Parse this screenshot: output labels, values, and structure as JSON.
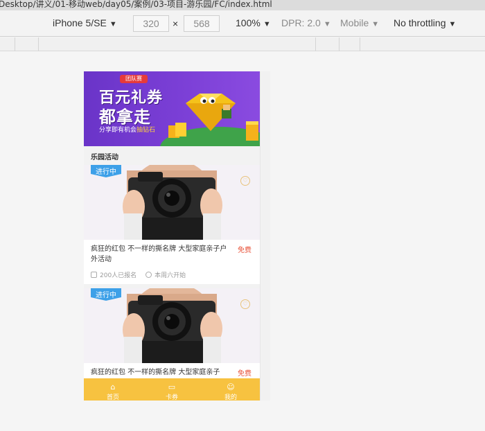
{
  "window": {
    "path": "Desktop/讲义/01-移动web/day05/案例/03-项目-游乐园/FC/index.html"
  },
  "devtools": {
    "device": "iPhone 5/SE",
    "width": "320",
    "times": "×",
    "height": "568",
    "zoom": "100%",
    "dpr": "DPR: 2.0",
    "mode": "Mobile",
    "throttle": "No throttling",
    "caret": "▼"
  },
  "banner": {
    "tag": "团队赛",
    "title1": "百元礼券",
    "title2": "都拿走",
    "subtitle_a": "分享即有机会",
    "subtitle_b": "抽钻石"
  },
  "section": {
    "title": "乐园活动"
  },
  "cards": [
    {
      "badge": "进行中",
      "heart_icon": "heart-icon",
      "desc": "疯狂的红包 不一样的撕名牌 大型家庭亲子户外活动",
      "price": "免费",
      "signups": "200人已报名",
      "start": "本周六开始"
    },
    {
      "badge": "进行中",
      "heart_icon": "heart-icon",
      "desc": "疯狂的红包 不一样的撕名牌 大型家庭亲子",
      "price": "免费"
    }
  ],
  "tabs": [
    {
      "label": "首页",
      "icon": "home-icon"
    },
    {
      "label": "卡券",
      "icon": "ticket-icon"
    },
    {
      "label": "我的",
      "icon": "user-icon"
    }
  ],
  "colors": {
    "tabbar": "#f7c240",
    "banner": "#7b3fd6",
    "badge": "#3da0e8",
    "price": "#e8533a"
  }
}
